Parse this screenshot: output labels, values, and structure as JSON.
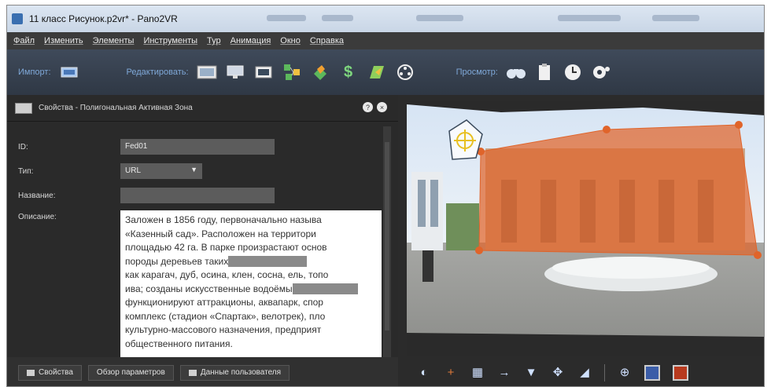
{
  "window": {
    "title": "11 класс Рисунок.p2vr* - Pano2VR"
  },
  "menu": [
    "Файл",
    "Изменить",
    "Элементы",
    "Инструменты",
    "Тур",
    "Анимация",
    "Окно",
    "Справка"
  ],
  "toolbar": {
    "import_label": "Импорт:",
    "edit_label": "Редактировать:",
    "preview_label": "Просмотр:",
    "icons": [
      "import-panorama-icon",
      "image-icon",
      "monitor-icon",
      "grid-icon",
      "tour-icon",
      "skin-icon",
      "map-icon",
      "animation-icon",
      "dollar-icon",
      "binoculars-icon",
      "clipboard-icon",
      "clock-icon",
      "settings-icon"
    ]
  },
  "panel": {
    "title": "Свойства - Полигональная Активная Зона",
    "id_label": "ID:",
    "id_value": "Fed01",
    "type_label": "Тип:",
    "type_value": "URL",
    "name_label": "Название:",
    "name_value": "",
    "desc_label": "Описание:",
    "desc_lines": [
      "Заложен в 1856 году, первоначально называ",
      "«Казенный сад». Расположен на территори",
      "площадью 42 га. В парке произрастают основ",
      "породы деревьев таких",
      "как карагач, дуб, осина, клен, сосна, ель, топо",
      "ива; созданы искусственные водоёмы",
      "функционируют аттракционы, аквапарк, спор",
      "комплекс (стадион «Спартак», велотрек), пло",
      "культурно-массового назначения, предприят",
      "общественного питания."
    ]
  },
  "bottom_tabs": [
    "Свойства",
    "Обзор параметров",
    "Данные пользователя"
  ],
  "colors": {
    "accent": "#7fa8d8",
    "hotspot": "#e0642a"
  }
}
